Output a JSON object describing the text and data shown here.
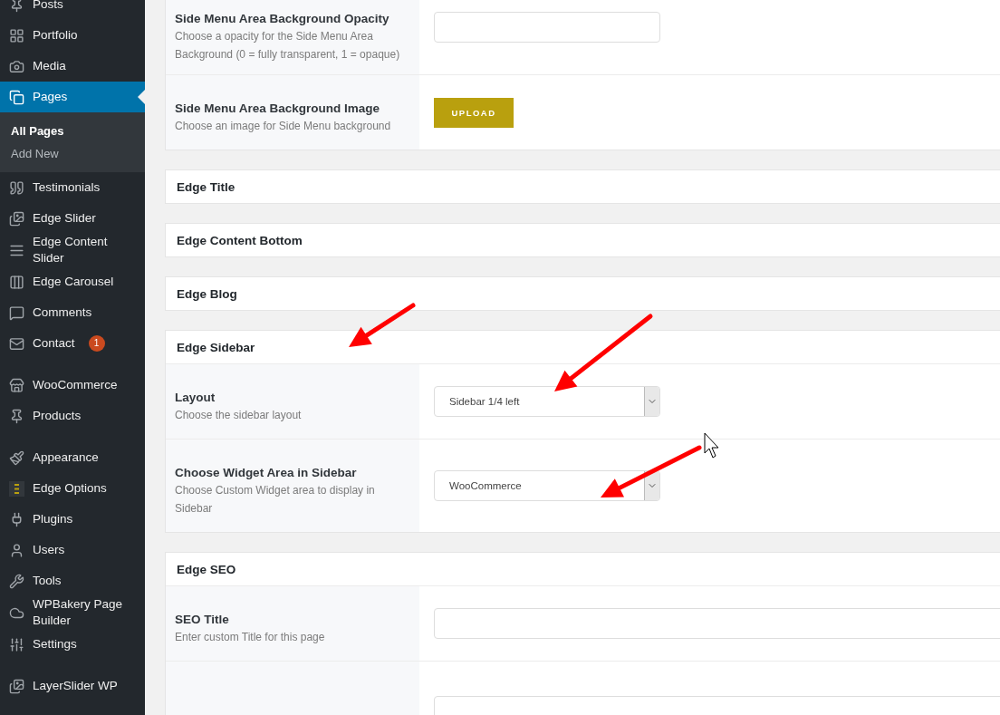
{
  "sidebar": {
    "groups": [
      {
        "items": [
          {
            "label": "Posts",
            "selected": false
          },
          {
            "label": "Portfolio",
            "selected": false
          },
          {
            "label": "Media",
            "selected": false
          },
          {
            "label": "Pages",
            "selected": true,
            "children": [
              {
                "label": "All Pages",
                "selected": true
              },
              {
                "label": "Add New",
                "selected": false
              }
            ]
          },
          {
            "label": "Testimonials",
            "selected": false
          },
          {
            "label": "Edge Slider",
            "selected": false
          },
          {
            "label": "Edge Content Slider",
            "selected": false
          },
          {
            "label": "Edge Carousel",
            "selected": false
          },
          {
            "label": "Comments",
            "selected": false
          },
          {
            "label": "Contact",
            "selected": false,
            "badge": "1"
          }
        ]
      },
      {
        "items": [
          {
            "label": "WooCommerce",
            "selected": false
          },
          {
            "label": "Products",
            "selected": false
          }
        ]
      },
      {
        "items": [
          {
            "label": "Appearance",
            "selected": false
          },
          {
            "label": "Edge Options",
            "selected": false
          },
          {
            "label": "Plugins",
            "selected": false
          },
          {
            "label": "Users",
            "selected": false
          },
          {
            "label": "Tools",
            "selected": false
          },
          {
            "label": "WPBakery Page Builder",
            "selected": false
          },
          {
            "label": "Settings",
            "selected": false
          }
        ]
      },
      {
        "items": [
          {
            "label": "LayerSlider WP",
            "selected": false
          }
        ]
      }
    ]
  },
  "sections": [
    {
      "rows": [
        {
          "label": "Side Menu Area Background Opacity",
          "description": "Choose a opacity for the Side Menu Area Background (0 = fully transparent, 1 = opaque)",
          "control": {
            "kind": "text"
          }
        },
        {
          "label": "Side Menu Area Background Image",
          "description": "Choose an image for Side Menu background",
          "control": {
            "kind": "upload",
            "label": "UPLOAD"
          }
        }
      ]
    },
    {
      "title": "Edge Title"
    },
    {
      "title": "Edge Content Bottom"
    },
    {
      "title": "Edge Blog"
    },
    {
      "title": "Edge Sidebar",
      "rows": [
        {
          "label": "Layout",
          "description": "Choose the sidebar layout",
          "control": {
            "kind": "select",
            "value": "Sidebar 1/4 left"
          }
        },
        {
          "label": "Choose Widget Area in Sidebar",
          "description": "Choose Custom Widget area to display in Sidebar",
          "control": {
            "kind": "select",
            "value": "WooCommerce"
          }
        }
      ]
    },
    {
      "title": "Edge SEO",
      "rows": [
        {
          "label": "SEO Title",
          "description": "Enter custom Title for this page",
          "control": {
            "kind": "text",
            "wide": true
          }
        },
        {
          "control": {
            "kind": "text",
            "wide": true
          }
        }
      ]
    }
  ]
}
